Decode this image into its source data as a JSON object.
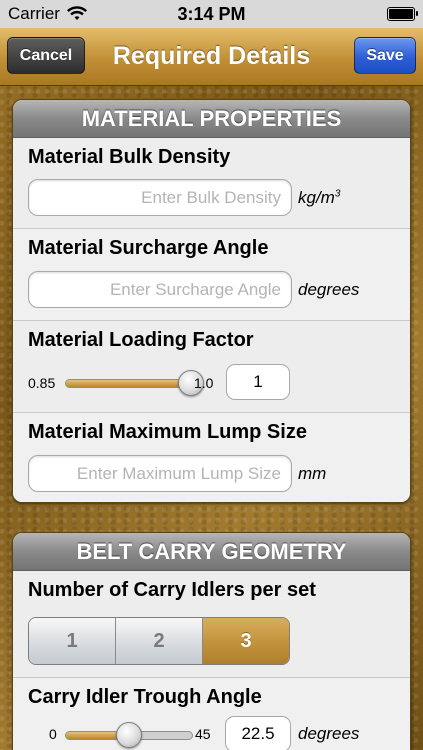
{
  "status_bar": {
    "carrier": "Carrier",
    "time": "3:14 PM"
  },
  "nav": {
    "title": "Required Details",
    "cancel_label": "Cancel",
    "save_label": "Save"
  },
  "material_properties": {
    "header": "MATERIAL PROPERTIES",
    "bulk_density": {
      "label": "Material Bulk Density",
      "placeholder": "Enter Bulk Density",
      "unit": "kg/m",
      "unit_superscript": "3"
    },
    "surcharge_angle": {
      "label": "Material Surcharge Angle",
      "placeholder": "Enter Surcharge Angle",
      "unit": "degrees"
    },
    "loading_factor": {
      "label": "Material Loading Factor",
      "min": "0.85",
      "max": "1.0",
      "value": "1",
      "slider_fraction": 1.0
    },
    "lump_size": {
      "label": "Material Maximum Lump Size",
      "placeholder": "Enter Maximum Lump Size",
      "unit": "mm"
    }
  },
  "belt_carry_geometry": {
    "header": "BELT CARRY GEOMETRY",
    "carry_idlers": {
      "label": "Number of Carry Idlers per set",
      "options": [
        "1",
        "2",
        "3"
      ],
      "selected": "3"
    },
    "trough_angle": {
      "label": "Carry Idler Trough Angle",
      "min": "0",
      "max": "45",
      "value": "22.5",
      "unit": "degrees",
      "slider_fraction": 0.5
    }
  }
}
